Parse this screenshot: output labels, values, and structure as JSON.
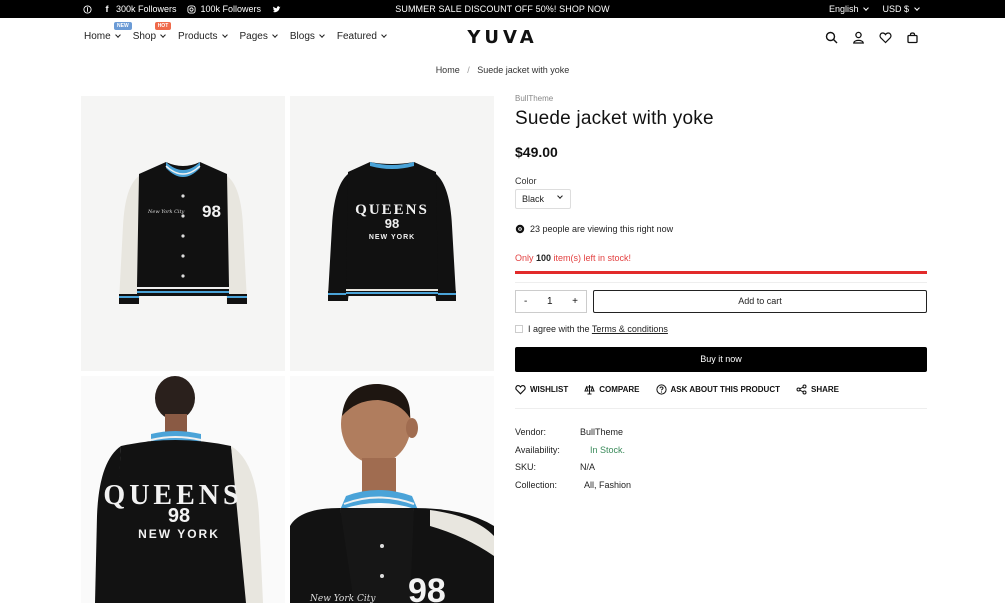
{
  "topbar": {
    "followers_fb": "300k Followers",
    "followers_ig": "100k Followers",
    "announcement": "SUMMER SALE DISCOUNT OFF 50%! SHOP NOW",
    "language": "English",
    "currency": "USD $",
    "icons": [
      "pinterest-icon",
      "facebook-icon",
      "instagram-icon",
      "twitter-icon"
    ]
  },
  "header": {
    "logo": "YUVA",
    "nav": [
      {
        "label": "Home",
        "badge": "NEW"
      },
      {
        "label": "Shop",
        "badge": "HOT"
      },
      {
        "label": "Products"
      },
      {
        "label": "Pages"
      },
      {
        "label": "Blogs"
      },
      {
        "label": "Featured"
      }
    ],
    "icons": [
      "search-icon",
      "account-icon",
      "wishlist-heart-icon",
      "cart-bag-icon"
    ]
  },
  "breadcrumb": {
    "home": "Home",
    "separator": "/",
    "current": "Suede jacket with yoke"
  },
  "product": {
    "vendor": "BullTheme",
    "title": "Suede jacket with yoke",
    "price": "$49.00",
    "color_label": "Color",
    "color_value": "Black",
    "viewing": "23 people are viewing this right now",
    "stock_prefix": "Only ",
    "stock_count": "100",
    "stock_suffix": " item(s) left in stock!",
    "stock_level": 1.0,
    "quantity": "1",
    "qty_minus": "-",
    "qty_plus": "+",
    "add_to_cart": "Add to cart",
    "agree_text": "I agree with the ",
    "terms_link": "Terms & conditions",
    "buy_now": "Buy it now",
    "actions": {
      "wishlist": "WISHLIST",
      "compare": "COMPARE",
      "ask": "ASK ABOUT THIS PRODUCT",
      "share": "SHARE"
    },
    "meta": {
      "vendor_label": "Vendor:",
      "vendor_value": "BullTheme",
      "availability_label": "Availability:",
      "availability_value": "In Stock.",
      "sku_label": "SKU:",
      "sku_value": "N/A",
      "collection_label": "Collection:",
      "collection_value": "All, Fashion"
    }
  },
  "gallery": {
    "jacket_number": "98",
    "back_text_top": "QUEENS",
    "back_text_bottom": "NEW YORK",
    "script_text": "New York City"
  },
  "colors": {
    "accent_red": "#e22a2a",
    "in_stock_green": "#3a8a5a",
    "black": "#000000"
  }
}
